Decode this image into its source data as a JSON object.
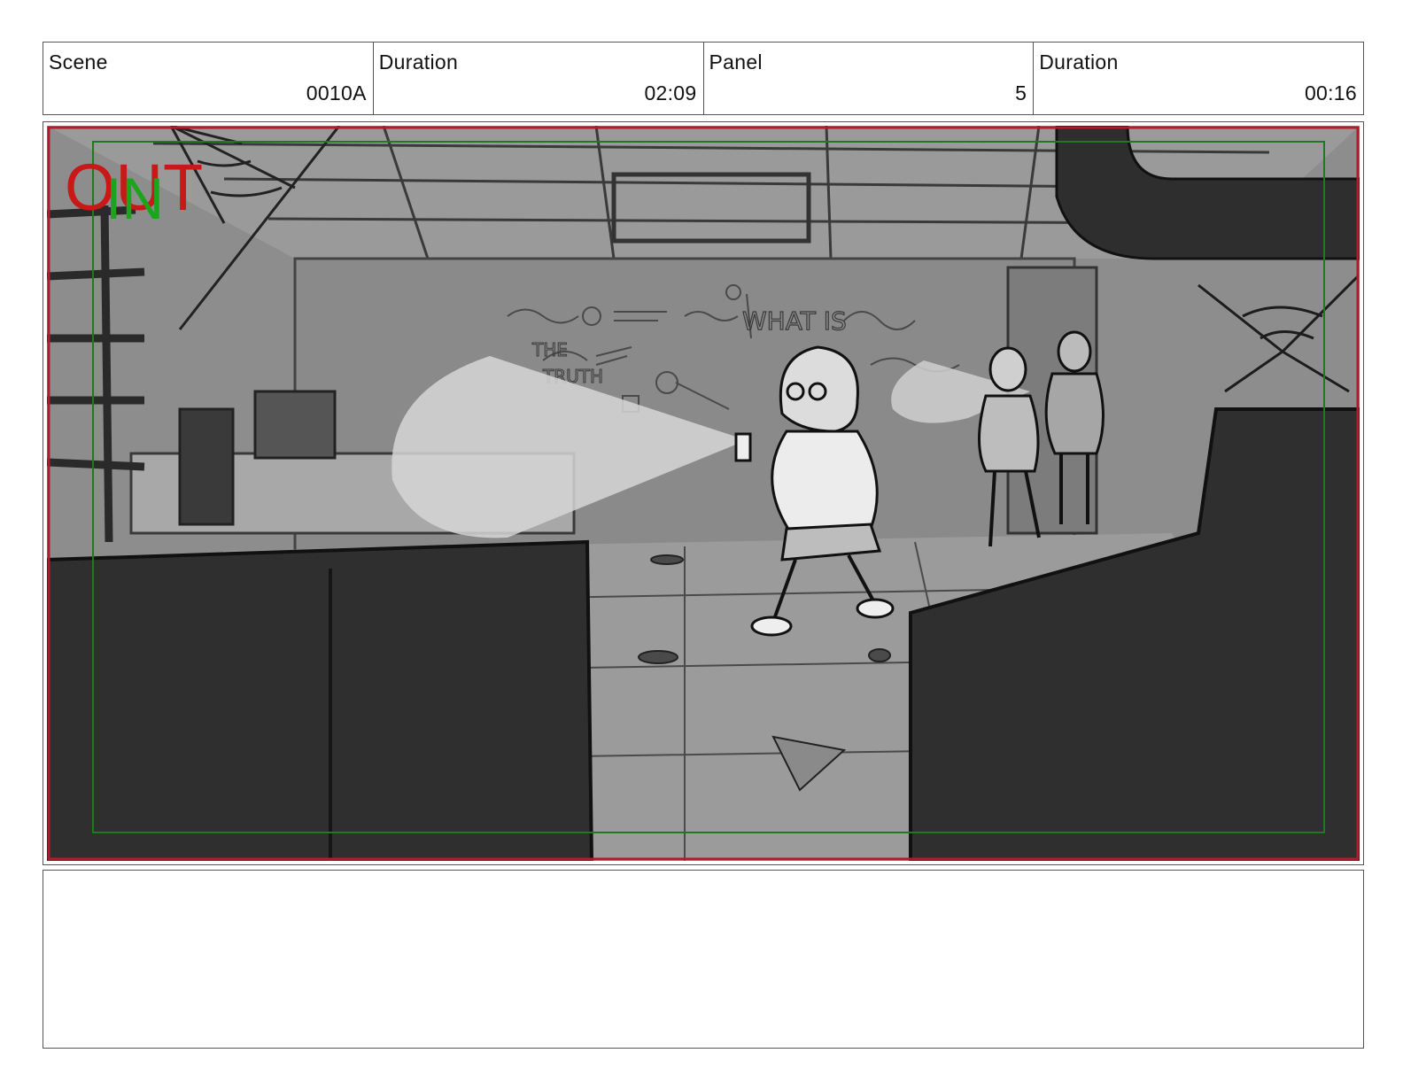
{
  "header": {
    "scene_label": "Scene",
    "scene_value": "0010A",
    "scene_duration_label": "Duration",
    "scene_duration_value": "02:09",
    "panel_label": "Panel",
    "panel_value": "5",
    "panel_duration_label": "Duration",
    "panel_duration_value": "00:16"
  },
  "frame": {
    "out_label": "OUT",
    "in_label": "IN",
    "wall_text_1": "WHAT IS",
    "wall_text_2": "THE",
    "wall_text_3": "TRUTH",
    "colors": {
      "out": "#c81818",
      "in": "#1aa51a",
      "safe_area": "#1f7a1f",
      "frame_border": "#b01c2a",
      "background": "#8a8a8a",
      "dark_fg": "#2f2f2f"
    }
  },
  "notes": {
    "text": ""
  }
}
